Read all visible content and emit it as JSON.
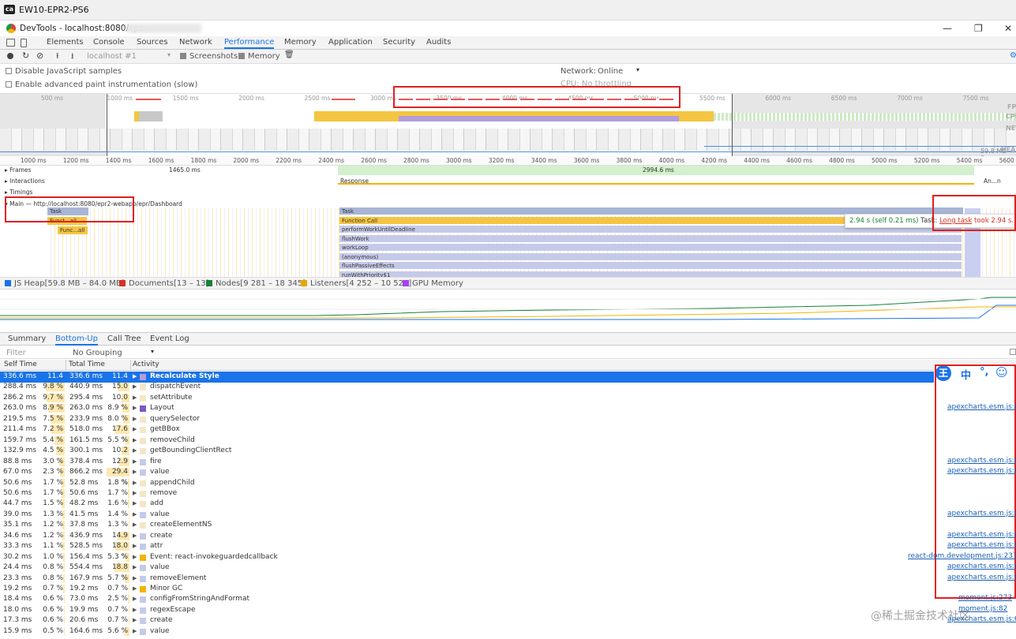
{
  "window": {
    "title": "EW10-EPR2-PS6",
    "logo": "ca"
  },
  "devtools_title": "DevTools - localhost:8080/epr...",
  "tabs": [
    "Elements",
    "Console",
    "Sources",
    "Network",
    "Performance",
    "Memory",
    "Application",
    "Security",
    "Audits"
  ],
  "toolbar": {
    "profile_select": "localhost #1",
    "screenshots": "Screenshots",
    "memory": "Memory"
  },
  "settings": {
    "disable_js": "Disable JavaScript samples",
    "advanced_paint": "Enable advanced paint instrumentation (slow)",
    "network": "Network:",
    "network_value": "Online",
    "cpu": "CPU: No throttling"
  },
  "overview_ticks": [
    "500 ms",
    "1000 ms",
    "1500 ms",
    "2000 ms",
    "2500 ms",
    "3000 ms",
    "3500 ms",
    "4000 ms",
    "4500 ms",
    "5000 ms",
    "5500 ms",
    "6000 ms",
    "6500 ms",
    "7000 ms",
    "7500 ms"
  ],
  "overview_side": [
    "FPS",
    "CPU",
    "NET",
    "HEAP"
  ],
  "heap_label": "59.8 MB – 8...",
  "ruler_ticks": [
    "1000 ms",
    "1200 ms",
    "1400 ms",
    "1600 ms",
    "1800 ms",
    "2000 ms",
    "2200 ms",
    "2400 ms",
    "2600 ms",
    "2800 ms",
    "3000 ms",
    "3200 ms",
    "3400 ms",
    "3600 ms",
    "3800 ms",
    "4000 ms",
    "4200 ms",
    "4400 ms",
    "4600 ms",
    "4800 ms",
    "5000 ms",
    "5200 ms",
    "5400 ms",
    "5600"
  ],
  "tracks": {
    "frames": "Frames",
    "interactions": "Interactions",
    "timings": "Timings",
    "main": "Main — http://localhost:8080/epr2-webapp/epr/Dashboard",
    "frame_1": "1465.0 ms",
    "frame_2": "2994.6 ms",
    "response": "Response",
    "an": "An...n"
  },
  "flame_left": [
    "Task",
    "Funct...all",
    "Func...all"
  ],
  "flame_right": [
    "Task",
    "Function Call",
    "performWorkUntilDeadline",
    "flushWork",
    "workLoop",
    "(anonymous)",
    "flushPassiveEffects",
    "runWithPriority$1"
  ],
  "tooltip": {
    "time": "2.94 s (self 0.21 ms)",
    "prefix": "Task",
    "link": "Long task",
    "suffix": "took 2.94 s."
  },
  "legend": [
    {
      "label": "JS Heap[59.8 MB – 84.0 MB]",
      "color": "#1a73e8"
    },
    {
      "label": "Documents[13 – 13]",
      "color": "#d93025"
    },
    {
      "label": "Nodes[9 281 – 18 345]",
      "color": "#188038"
    },
    {
      "label": "Listeners[4 252 – 10 529]",
      "color": "#e8a600"
    },
    {
      "label": "GPU Memory",
      "color": "#a142f4"
    }
  ],
  "bottom_tabs": [
    "Summary",
    "Bottom-Up",
    "Call Tree",
    "Event Log"
  ],
  "filter": {
    "placeholder": "Filter",
    "grouping": "No Grouping"
  },
  "columns": [
    "Self Time",
    "Total Time",
    "Activity"
  ],
  "rows": [
    {
      "self": "336.6 ms",
      "selfp": "11.4 %",
      "total": "336.6 ms",
      "totalp": "11.4 %",
      "name": "Recalculate Style",
      "color": "#b39ddb",
      "sp": 11.4,
      "tp": 11.4
    },
    {
      "self": "288.4 ms",
      "selfp": "9.8 %",
      "total": "440.9 ms",
      "totalp": "15.0 %",
      "name": "dispatchEvent",
      "color": "#f5e6c8",
      "sp": 9.8,
      "tp": 15.0
    },
    {
      "self": "286.2 ms",
      "selfp": "9.7 %",
      "total": "295.4 ms",
      "totalp": "10.0 %",
      "name": "setAttribute",
      "color": "#f5e6c8",
      "sp": 9.7,
      "tp": 10.0
    },
    {
      "self": "263.0 ms",
      "selfp": "8.9 %",
      "total": "263.0 ms",
      "totalp": "8.9 %",
      "name": "Layout",
      "color": "#7e57c2",
      "sp": 8.9,
      "tp": 8.9
    },
    {
      "self": "219.5 ms",
      "selfp": "7.5 %",
      "total": "233.9 ms",
      "totalp": "8.0 %",
      "name": "querySelector",
      "color": "#f5e6c8",
      "sp": 7.5,
      "tp": 8.0
    },
    {
      "self": "211.4 ms",
      "selfp": "7.2 %",
      "total": "518.0 ms",
      "totalp": "17.6 %",
      "name": "getBBox",
      "color": "#f5e6c8",
      "sp": 7.2,
      "tp": 17.6
    },
    {
      "self": "159.7 ms",
      "selfp": "5.4 %",
      "total": "161.5 ms",
      "totalp": "5.5 %",
      "name": "removeChild",
      "color": "#f5e6c8",
      "sp": 5.4,
      "tp": 5.5
    },
    {
      "self": "132.9 ms",
      "selfp": "4.5 %",
      "total": "300.1 ms",
      "totalp": "10.2 %",
      "name": "getBoundingClientRect",
      "color": "#f5e6c8",
      "sp": 4.5,
      "tp": 10.2
    },
    {
      "self": "88.8 ms",
      "selfp": "3.0 %",
      "total": "378.4 ms",
      "totalp": "12.9 %",
      "name": "fire",
      "color": "#c5cae9",
      "sp": 3.0,
      "tp": 12.9
    },
    {
      "self": "67.0 ms",
      "selfp": "2.3 %",
      "total": "866.2 ms",
      "totalp": "29.4 %",
      "name": "value",
      "color": "#c5cae9",
      "sp": 2.3,
      "tp": 29.4
    },
    {
      "self": "50.6 ms",
      "selfp": "1.7 %",
      "total": "52.8 ms",
      "totalp": "1.8 %",
      "name": "appendChild",
      "color": "#f5e6c8",
      "sp": 1.7,
      "tp": 1.8
    },
    {
      "self": "50.6 ms",
      "selfp": "1.7 %",
      "total": "50.6 ms",
      "totalp": "1.7 %",
      "name": "remove",
      "color": "#f5e6c8",
      "sp": 1.7,
      "tp": 1.7
    },
    {
      "self": "44.7 ms",
      "selfp": "1.5 %",
      "total": "48.2 ms",
      "totalp": "1.6 %",
      "name": "add",
      "color": "#f5e6c8",
      "sp": 1.5,
      "tp": 1.6
    },
    {
      "self": "39.0 ms",
      "selfp": "1.3 %",
      "total": "41.5 ms",
      "totalp": "1.4 %",
      "name": "value",
      "color": "#c5cae9",
      "sp": 1.3,
      "tp": 1.4
    },
    {
      "self": "35.1 ms",
      "selfp": "1.2 %",
      "total": "37.8 ms",
      "totalp": "1.3 %",
      "name": "createElementNS",
      "color": "#f5e6c8",
      "sp": 1.2,
      "tp": 1.3
    },
    {
      "self": "34.6 ms",
      "selfp": "1.2 %",
      "total": "436.9 ms",
      "totalp": "14.9 %",
      "name": "create",
      "color": "#c5cae9",
      "sp": 1.2,
      "tp": 14.9
    },
    {
      "self": "33.3 ms",
      "selfp": "1.1 %",
      "total": "528.5 ms",
      "totalp": "18.0 %",
      "name": "attr",
      "color": "#c5cae9",
      "sp": 1.1,
      "tp": 18.0
    },
    {
      "self": "30.2 ms",
      "selfp": "1.0 %",
      "total": "156.4 ms",
      "totalp": "5.3 %",
      "name": "Event: react-invokeguardedcallback",
      "color": "#f4b400",
      "sp": 1.0,
      "tp": 5.3
    },
    {
      "self": "24.4 ms",
      "selfp": "0.8 %",
      "total": "554.4 ms",
      "totalp": "18.8 %",
      "name": "value",
      "color": "#c5cae9",
      "sp": 0.8,
      "tp": 18.8
    },
    {
      "self": "23.3 ms",
      "selfp": "0.8 %",
      "total": "167.9 ms",
      "totalp": "5.7 %",
      "name": "removeElement",
      "color": "#c5cae9",
      "sp": 0.8,
      "tp": 5.7
    },
    {
      "self": "19.2 ms",
      "selfp": "0.7 %",
      "total": "19.2 ms",
      "totalp": "0.7 %",
      "name": "Minor GC",
      "color": "#f4b400",
      "sp": 0.7,
      "tp": 0.7
    },
    {
      "self": "18.4 ms",
      "selfp": "0.6 %",
      "total": "73.0 ms",
      "totalp": "2.5 %",
      "name": "configFromStringAndFormat",
      "color": "#c5cae9",
      "sp": 0.6,
      "tp": 2.5
    },
    {
      "self": "18.0 ms",
      "selfp": "0.6 %",
      "total": "19.9 ms",
      "totalp": "0.7 %",
      "name": "regexEscape",
      "color": "#c5cae9",
      "sp": 0.6,
      "tp": 0.7
    },
    {
      "self": "17.3 ms",
      "selfp": "0.6 %",
      "total": "20.6 ms",
      "totalp": "0.7 %",
      "name": "create",
      "color": "#c5cae9",
      "sp": 0.6,
      "tp": 0.7
    },
    {
      "self": "15.9 ms",
      "selfp": "0.5 %",
      "total": "164.6 ms",
      "totalp": "5.6 %",
      "name": "value",
      "color": "#c5cae9",
      "sp": 0.5,
      "tp": 5.6
    }
  ],
  "links": [
    {
      "row": 3,
      "text": "apexcharts.esm.js:6"
    },
    {
      "row": 8,
      "text": "apexcharts.esm.js:6"
    },
    {
      "row": 9,
      "text": "apexcharts.esm.js:6"
    },
    {
      "row": 13,
      "text": "apexcharts.esm.js:6"
    },
    {
      "row": 15,
      "text": "apexcharts.esm.js:6"
    },
    {
      "row": 16,
      "text": "apexcharts.esm.js:6"
    },
    {
      "row": 17,
      "text": "react-dom.development.js:237"
    },
    {
      "row": 18,
      "text": "apexcharts.esm.js:6"
    },
    {
      "row": 19,
      "text": "apexcharts.esm.js:6"
    },
    {
      "row": 21,
      "text": "moment.js:273"
    },
    {
      "row": 22,
      "text": "moment.js:82"
    },
    {
      "row": 23,
      "text": "apexcharts.esm.js:6"
    }
  ],
  "ime": {
    "logo": "王",
    "lang": "中",
    "punct": "°,",
    "emoji": "☺"
  },
  "watermark": "@稀土掘金技术社区"
}
